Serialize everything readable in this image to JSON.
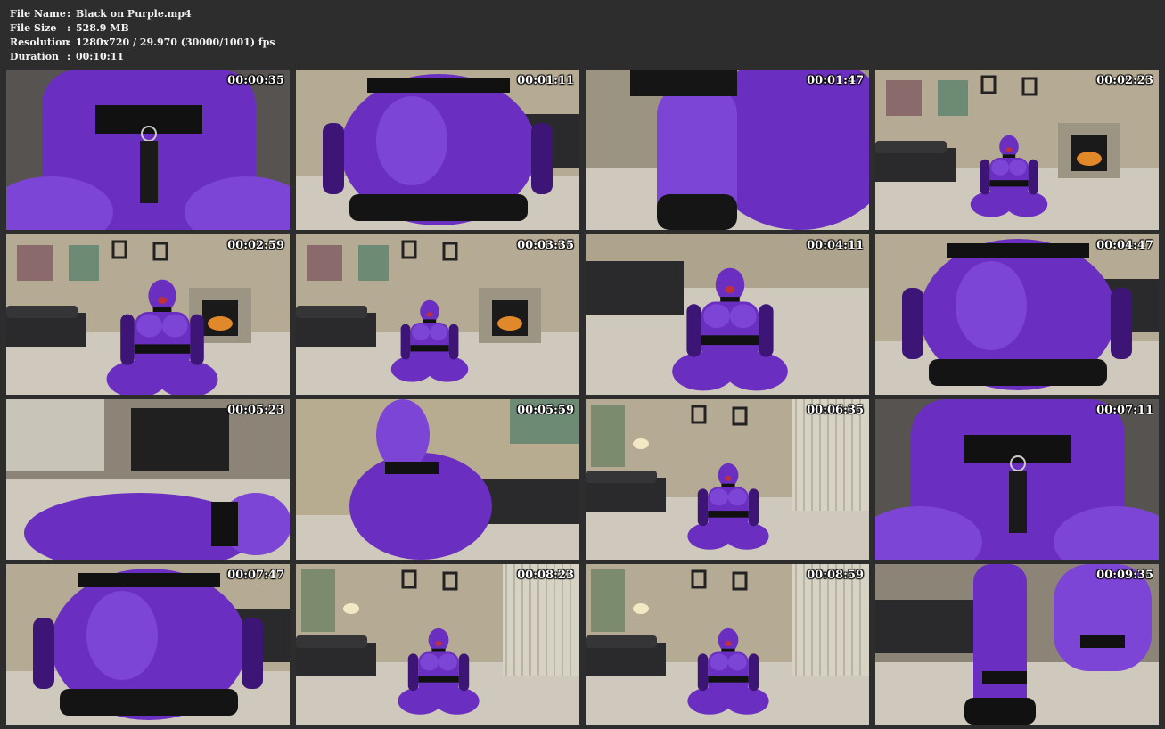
{
  "file_info": [
    {
      "key": "File Name",
      "value": "Black on Purple.mp4"
    },
    {
      "key": "File Size",
      "value": "528.9 MB"
    },
    {
      "key": "Resolution",
      "value": "1280x720 / 29.970 (30000/1001) fps"
    },
    {
      "key": "Duration",
      "value": "00:10:11"
    }
  ],
  "separator": ":",
  "thumbnails": [
    {
      "timestamp": "00:00:35",
      "scene": "closeup-torso"
    },
    {
      "timestamp": "00:01:11",
      "scene": "rear-kneel"
    },
    {
      "timestamp": "00:01:47",
      "scene": "closeup-hand"
    },
    {
      "timestamp": "00:02:23",
      "scene": "room-wide-fireplace"
    },
    {
      "timestamp": "00:02:59",
      "scene": "room-mid-fireplace"
    },
    {
      "timestamp": "00:03:35",
      "scene": "room-wide-fireplace"
    },
    {
      "timestamp": "00:04:11",
      "scene": "front-kneel"
    },
    {
      "timestamp": "00:04:47",
      "scene": "rear-kneel"
    },
    {
      "timestamp": "00:05:23",
      "scene": "floor-lying"
    },
    {
      "timestamp": "00:05:59",
      "scene": "side-kneel"
    },
    {
      "timestamp": "00:06:35",
      "scene": "room-wide-window"
    },
    {
      "timestamp": "00:07:11",
      "scene": "closeup-torso"
    },
    {
      "timestamp": "00:07:47",
      "scene": "rear-kneel"
    },
    {
      "timestamp": "00:08:23",
      "scene": "room-wide-window"
    },
    {
      "timestamp": "00:08:59",
      "scene": "room-wide-window"
    },
    {
      "timestamp": "00:09:35",
      "scene": "closeup-legs"
    }
  ],
  "colors": {
    "background": "#2d2d2d",
    "latex_purple": "#6a2fc0",
    "latex_dark": "#3d1577",
    "carpet": "#cfc8bd",
    "wall": "#b5aa93",
    "furniture": "#2a2a2c"
  }
}
